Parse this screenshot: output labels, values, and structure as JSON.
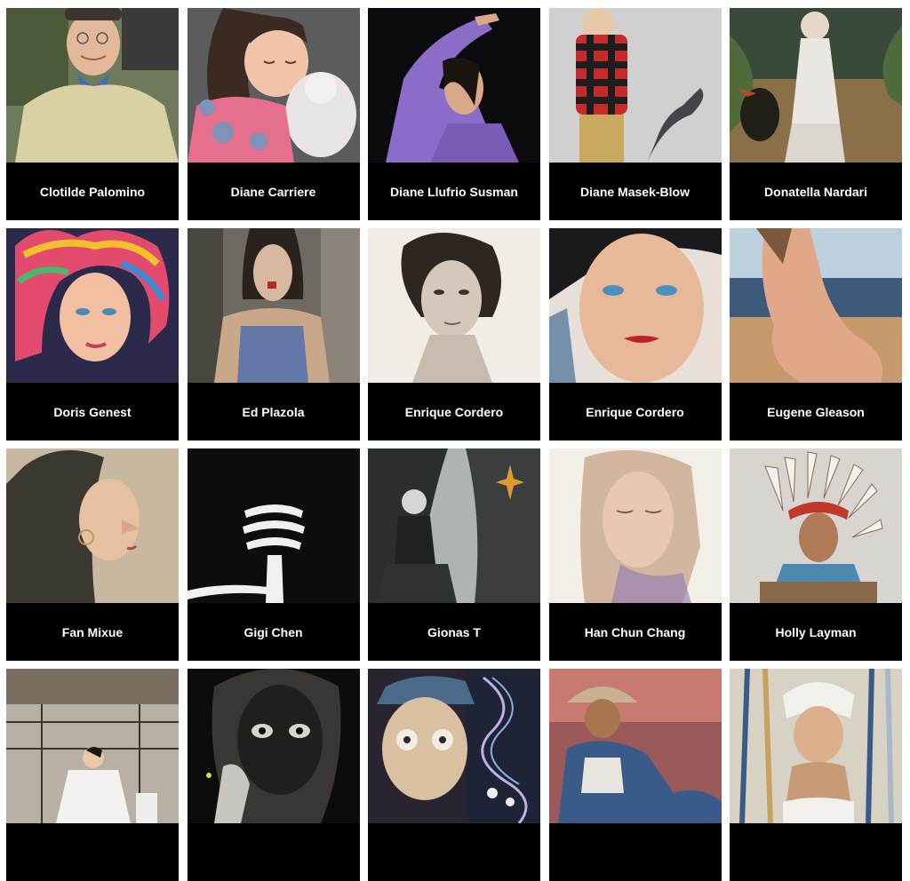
{
  "gallery": {
    "artists": [
      {
        "name": "Clotilde Palomino",
        "image": "elderly-man-portrait"
      },
      {
        "name": "Diane Carriere",
        "image": "girl-hugging-cat"
      },
      {
        "name": "Diane Llufrio Susman",
        "image": "man-purple-shirt-pointing"
      },
      {
        "name": "Diane Masek-Blow",
        "image": "boy-plaid-shirt-shadow"
      },
      {
        "name": "Donatella Nardari",
        "image": "woman-white-dress-bird"
      },
      {
        "name": "Doris Genest",
        "image": "woman-rainbow-curls"
      },
      {
        "name": "Ed Plazola",
        "image": "woman-blue-lace"
      },
      {
        "name": "Enrique Cordero",
        "image": "charcoal-woman-portrait"
      },
      {
        "name": "Enrique Cordero",
        "image": "woman-blue-eyes-face"
      },
      {
        "name": "Eugene Gleason",
        "image": "nude-on-beach"
      },
      {
        "name": "Fan Mixue",
        "image": "woman-profile-earring"
      },
      {
        "name": "Gigi Chen",
        "image": "striped-hand-shush"
      },
      {
        "name": "Gionas T",
        "image": "man-seated-forest-star"
      },
      {
        "name": "Han Chun Chang",
        "image": "watercolor-woman-face"
      },
      {
        "name": "Holly Layman",
        "image": "native-headdress-figure"
      },
      {
        "name": "",
        "image": "bride-in-room"
      },
      {
        "name": "",
        "image": "dark-face-hand"
      },
      {
        "name": "",
        "image": "old-man-blue-swirls"
      },
      {
        "name": "",
        "image": "man-hat-denim"
      },
      {
        "name": "",
        "image": "woman-white-headwrap"
      }
    ]
  }
}
